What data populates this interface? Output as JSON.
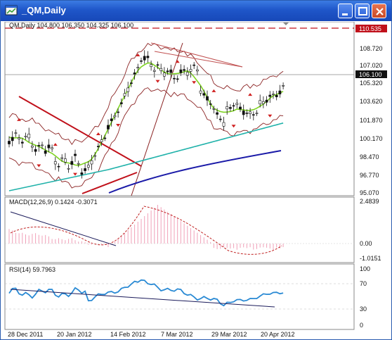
{
  "window": {
    "title": "_QM,Daily",
    "icon": "chart-window-icon",
    "buttons": [
      "minimize-icon",
      "restore-icon",
      "close-icon"
    ]
  },
  "main_panel": {
    "header": "QM,Daily  104.800 106.350 104.325 106.100",
    "price_label_top": "110.535",
    "price_label_current": "106.100",
    "y_ticks": [
      "108.720",
      "107.020",
      "105.320",
      "103.620",
      "101.870",
      "100.170",
      "98.470",
      "96.770",
      "95.070"
    ]
  },
  "macd_panel": {
    "header": "MACD(12,26,9) 0.1424 -0.3071",
    "y_ticks": [
      "2.4839",
      "0.00",
      "-1.0151"
    ]
  },
  "rsi_panel": {
    "header": "RSI(14) 59.7963",
    "y_ticks": [
      "100",
      "70",
      "30",
      "0"
    ]
  },
  "x_axis": {
    "labels": [
      "28 Dec 2011",
      "20 Jan 2012",
      "14 Feb 2012",
      "7 Mar 2012",
      "29 Mar 2012",
      "20 Apr 2012"
    ]
  },
  "colors": {
    "title_bar": "#1f56c9",
    "ma_fast": "#7ed321",
    "ma_mid": "#20b2aa",
    "ma_slow": "#1a1aa8",
    "bands": "#8b2323",
    "trend_red": "#c0101a",
    "resistance_line": "#c0101a",
    "rsi_line": "#2a8ad4"
  }
}
